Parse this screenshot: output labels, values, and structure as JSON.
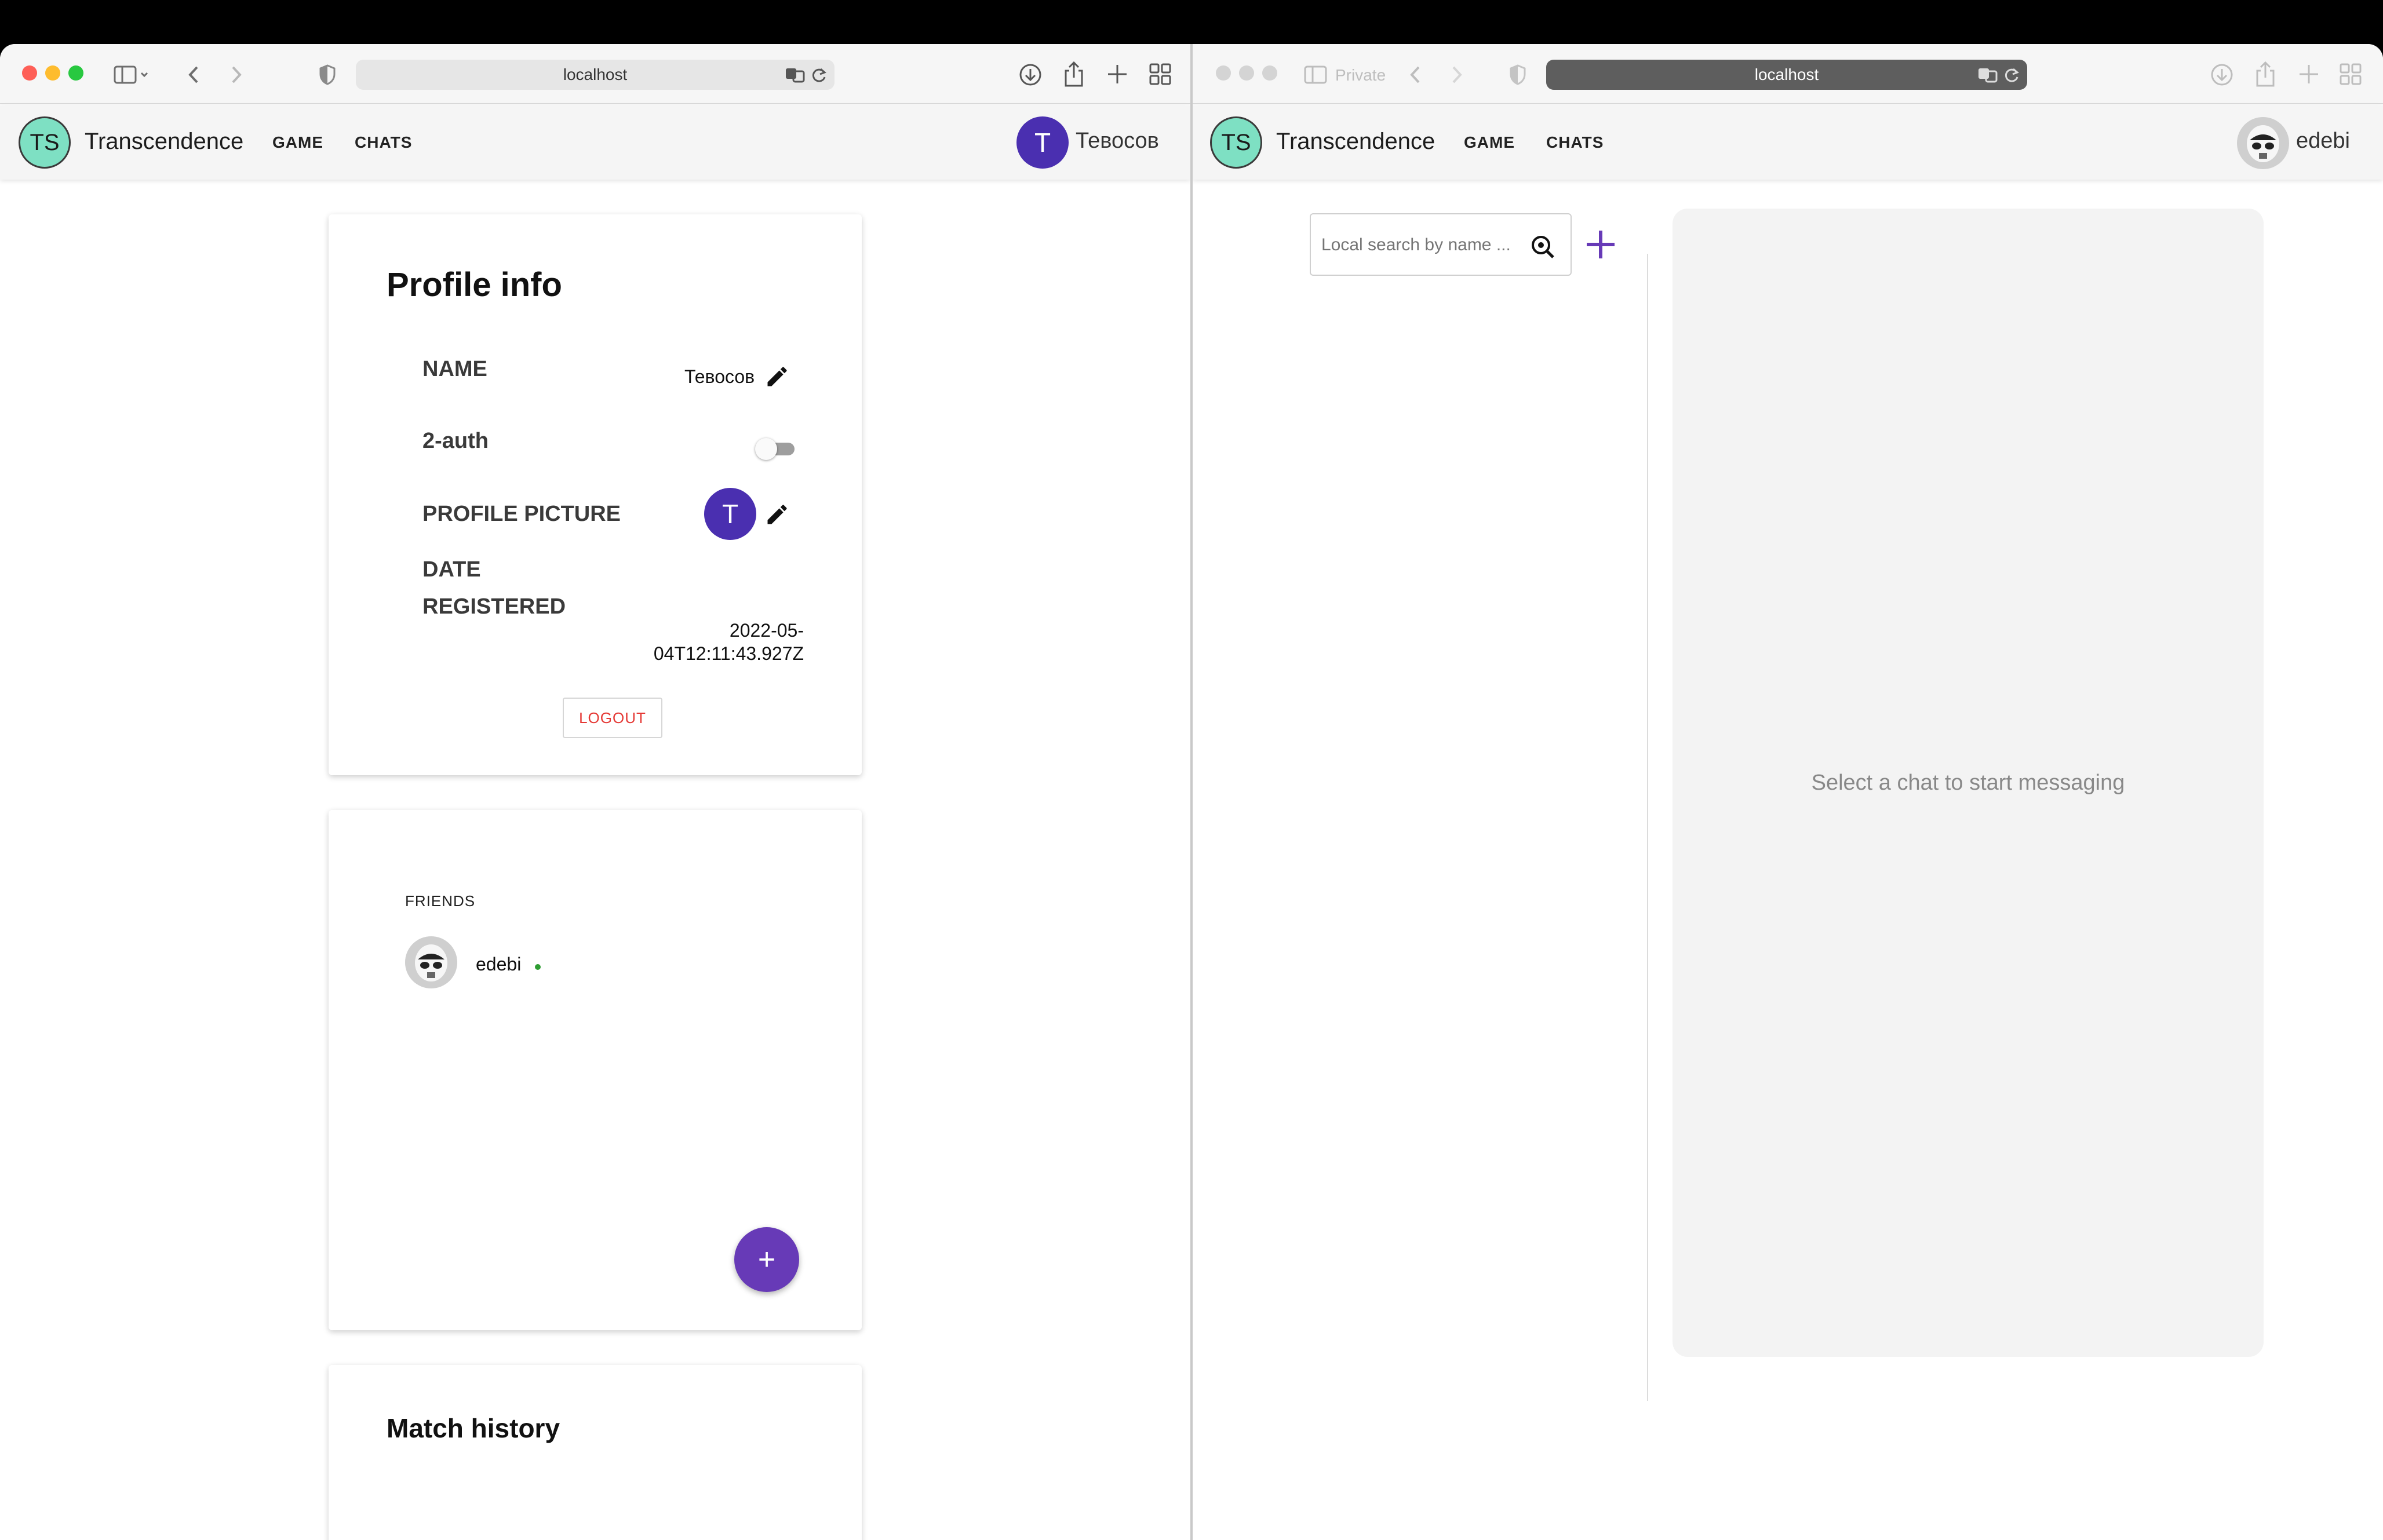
{
  "left_window": {
    "url": "localhost",
    "app": {
      "logo": "TS",
      "title": "Transcendence",
      "nav": [
        "GAME",
        "CHATS"
      ],
      "user_name": "Тевосов",
      "user_initial": "T"
    },
    "profile": {
      "title": "Profile info",
      "name_label": "NAME",
      "name_value": "Тевосов",
      "twofa_label": "2-auth",
      "twofa_enabled": false,
      "picture_label": "PROFILE PICTURE",
      "picture_initial": "T",
      "date_label_1": "DATE",
      "date_label_2": "REGISTERED",
      "date_value_1": "2022-05-",
      "date_value_2": "04T12:11:43.927Z",
      "logout": "LOGOUT"
    },
    "friends": {
      "title": "FRIENDS",
      "items": [
        {
          "name": "edebi",
          "online": true
        }
      ],
      "add_button": "+"
    },
    "match_history": {
      "title": "Match history"
    }
  },
  "right_window": {
    "url": "localhost",
    "private_label": "Private",
    "app": {
      "logo": "TS",
      "title": "Transcendence",
      "nav": [
        "GAME",
        "CHATS"
      ],
      "user_name": "edebi"
    },
    "search": {
      "placeholder": "Local search by name ..."
    },
    "empty_message": "Select a chat to start messaging"
  },
  "colors": {
    "accent": "#673ab7",
    "avatar": "#4a2fb0",
    "logo_bg": "#7ee0c3",
    "logout": "#e53935",
    "online": "#2e9d32"
  }
}
